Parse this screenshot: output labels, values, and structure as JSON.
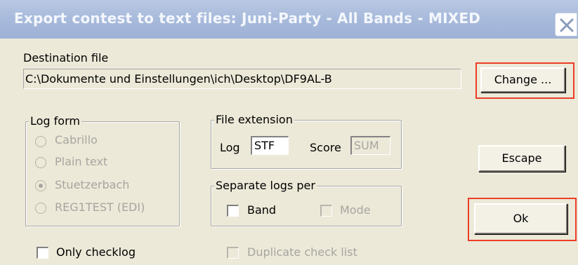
{
  "window": {
    "title": "Export contest to text files: Juni-Party - All Bands - MIXED",
    "close_icon": "close-icon"
  },
  "destination": {
    "label": "Destination file",
    "value": "C:\\Dokumente und Einstellungen\\ich\\Desktop\\DF9AL-B"
  },
  "buttons": {
    "change": "Change ...",
    "escape": "Escape",
    "ok": "Ok"
  },
  "log_form": {
    "legend": "Log form",
    "options": [
      {
        "label": "Cabrillo",
        "checked": false
      },
      {
        "label": "Plain text",
        "checked": false
      },
      {
        "label": "Stuetzerbach",
        "checked": true
      },
      {
        "label": "REG1TEST (EDI)",
        "checked": false
      }
    ]
  },
  "file_extension": {
    "legend": "File extension",
    "log_label": "Log",
    "log_value": "STF",
    "score_label": "Score",
    "score_value": "SUM"
  },
  "separate_logs": {
    "legend": "Separate logs per",
    "band_label": "Band",
    "mode_label": "Mode"
  },
  "options": {
    "only_checklog": "Only checklog",
    "duplicate_check_list": "Duplicate check list"
  },
  "highlight_color": "#ec3d27"
}
